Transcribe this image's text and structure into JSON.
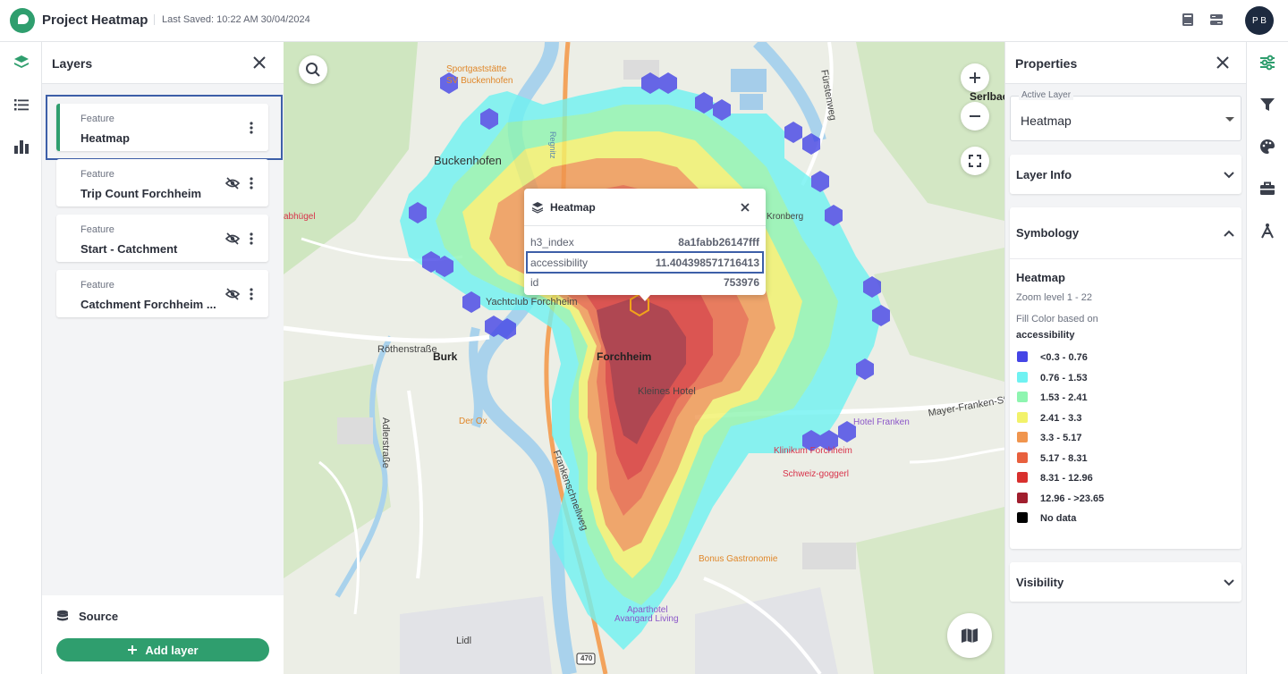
{
  "header": {
    "app_title": "Project Heatmap",
    "last_saved": "Last Saved: 10:22 AM 30/04/2024",
    "avatar_initials": "P B"
  },
  "left_rail": {
    "icons": [
      "layers-icon",
      "list-icon",
      "bar-chart-icon"
    ]
  },
  "layers_panel": {
    "title": "Layers",
    "layers": [
      {
        "type": "Feature",
        "name": "Heatmap",
        "active": true,
        "hidden": false
      },
      {
        "type": "Feature",
        "name": "Trip Count Forchheim",
        "active": false,
        "hidden": true
      },
      {
        "type": "Feature",
        "name": "Start - Catchment",
        "active": false,
        "hidden": true
      },
      {
        "type": "Feature",
        "name": "Catchment Forchheim ...",
        "active": false,
        "hidden": true
      }
    ],
    "source_label": "Source",
    "add_layer_label": "Add layer"
  },
  "map": {
    "labels": {
      "sportgaststatte": "Sportgaststätte",
      "sv_buckenhofen": "SV Buckenhofen",
      "buckenhofen": "Buckenhofen",
      "burk": "Burk",
      "forchheim": "Forchheim",
      "rothenstrasse": "Röthenstraße",
      "adlerstrasse": "Adlerstraße",
      "der_ox": "Der Ox",
      "yachtclub": "Yachtclub Forchheim",
      "kleines_hotel": "Kleines Hotel",
      "hotel_franken": "Hotel Franken",
      "klinikum": "Klinikum Forchheim",
      "schweizgoggerl": "Schweiz-goggerl",
      "gastronomie": "Bonus Gastronomie",
      "aparthotel": "Aparthotel",
      "avangard": "Avangard Living",
      "lidl": "Lidl",
      "mayer_franken": "Mayer-Franken-Straße",
      "fuerstenweg": "Fürstenweg",
      "serlbach": "Serlbac",
      "road_470": "470",
      "regnitz": "Regnitz",
      "frankenschnellweg": "Frankenschnellweg",
      "kronberg": "Kronberg",
      "abhuegel": "abhügel"
    },
    "popup": {
      "title": "Heatmap",
      "rows": [
        {
          "key": "h3_index",
          "value": "8a1fabb26147fff"
        },
        {
          "key": "accessibility",
          "value": "11.404398571716413"
        },
        {
          "key": "id",
          "value": "753976"
        }
      ]
    }
  },
  "properties_panel": {
    "title": "Properties",
    "active_layer_label": "Active Layer",
    "active_layer_value": "Heatmap",
    "sections": {
      "layer_info": "Layer Info",
      "symbology": "Symbology",
      "visibility": "Visibility"
    },
    "symbology": {
      "layer_name": "Heatmap",
      "zoom": "Zoom level 1 - 22",
      "fill_color_label": "Fill Color based on",
      "attribute": "accessibility",
      "legend": [
        {
          "label": "<0.3 - 0.76",
          "color": "#4545e6"
        },
        {
          "label": "0.76 - 1.53",
          "color": "#6ff2f2"
        },
        {
          "label": "1.53 - 2.41",
          "color": "#8ef5b0"
        },
        {
          "label": "2.41 - 3.3",
          "color": "#f2f26a"
        },
        {
          "label": "3.3 - 5.17",
          "color": "#f0954e"
        },
        {
          "label": "5.17 - 8.31",
          "color": "#e8603e"
        },
        {
          "label": "8.31 - 12.96",
          "color": "#d8302e"
        },
        {
          "label": "12.96 - >23.65",
          "color": "#a01e2e"
        },
        {
          "label": "No data",
          "color": "#000000"
        }
      ]
    }
  },
  "right_rail": {
    "icons": [
      "sliders-icon",
      "filter-icon",
      "palette-icon",
      "toolbox-icon",
      "compass-tool-icon"
    ]
  },
  "colors": {
    "brand": "#2f9e6e",
    "highlight": "#3d5fa8"
  }
}
